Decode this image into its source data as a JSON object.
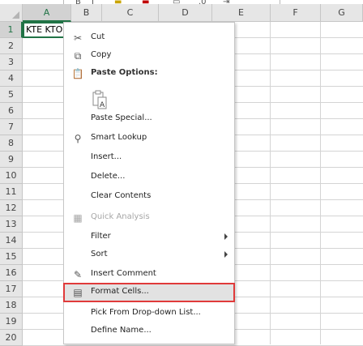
{
  "sheet": {
    "columns": [
      "A",
      "B",
      "C",
      "D",
      "E",
      "F",
      "G"
    ],
    "rows": [
      "1",
      "2",
      "3",
      "4",
      "5",
      "6",
      "7",
      "8",
      "9",
      "10",
      "11",
      "12",
      "13",
      "14",
      "15",
      "16",
      "17",
      "18",
      "19",
      "20"
    ],
    "selected_column": "A",
    "selected_row": "1",
    "cell_a1": "KTE KTO"
  },
  "context_menu": {
    "items": [
      {
        "id": "cut",
        "label": "Cut",
        "icon": "scissors-icon",
        "glyph": "✂",
        "disabled": false,
        "bold": false
      },
      {
        "id": "copy",
        "label": "Copy",
        "icon": "copy-icon",
        "glyph": "⧉",
        "disabled": false,
        "bold": false
      },
      {
        "id": "paste-options",
        "label": "Paste Options:",
        "icon": "clipboard-icon",
        "glyph": "📋",
        "disabled": false,
        "bold": true
      },
      {
        "id": "paste-special",
        "label": "Paste Special...",
        "icon": "",
        "glyph": "",
        "disabled": false,
        "bold": false
      },
      {
        "id": "smart-lookup",
        "label": "Smart Lookup",
        "icon": "magnifier-icon",
        "glyph": "⚲",
        "disabled": false,
        "bold": false
      },
      {
        "id": "insert",
        "label": "Insert...",
        "icon": "",
        "glyph": "",
        "disabled": false,
        "bold": false
      },
      {
        "id": "delete",
        "label": "Delete...",
        "icon": "",
        "glyph": "",
        "disabled": false,
        "bold": false
      },
      {
        "id": "clear-contents",
        "label": "Clear Contents",
        "icon": "",
        "glyph": "",
        "disabled": false,
        "bold": false
      },
      {
        "id": "quick-analysis",
        "label": "Quick Analysis",
        "icon": "quick-analysis-icon",
        "glyph": "▦",
        "disabled": true,
        "bold": false
      },
      {
        "id": "filter",
        "label": "Filter",
        "icon": "",
        "glyph": "",
        "disabled": false,
        "bold": false,
        "submenu": true
      },
      {
        "id": "sort",
        "label": "Sort",
        "icon": "",
        "glyph": "",
        "disabled": false,
        "bold": false,
        "submenu": true
      },
      {
        "id": "insert-comment",
        "label": "Insert Comment",
        "icon": "comment-icon",
        "glyph": "✎",
        "disabled": false,
        "bold": false
      },
      {
        "id": "format-cells",
        "label": "Format Cells...",
        "icon": "format-cells-icon",
        "glyph": "▤",
        "disabled": false,
        "bold": false,
        "highlighted": true
      },
      {
        "id": "pick-dropdown",
        "label": "Pick From Drop-down List...",
        "icon": "",
        "glyph": "",
        "disabled": false,
        "bold": false
      },
      {
        "id": "define-name",
        "label": "Define Name...",
        "icon": "",
        "glyph": "",
        "disabled": false,
        "bold": false
      }
    ]
  },
  "colors": {
    "highlight_border": "#e03a3a",
    "excel_green": "#217346"
  }
}
